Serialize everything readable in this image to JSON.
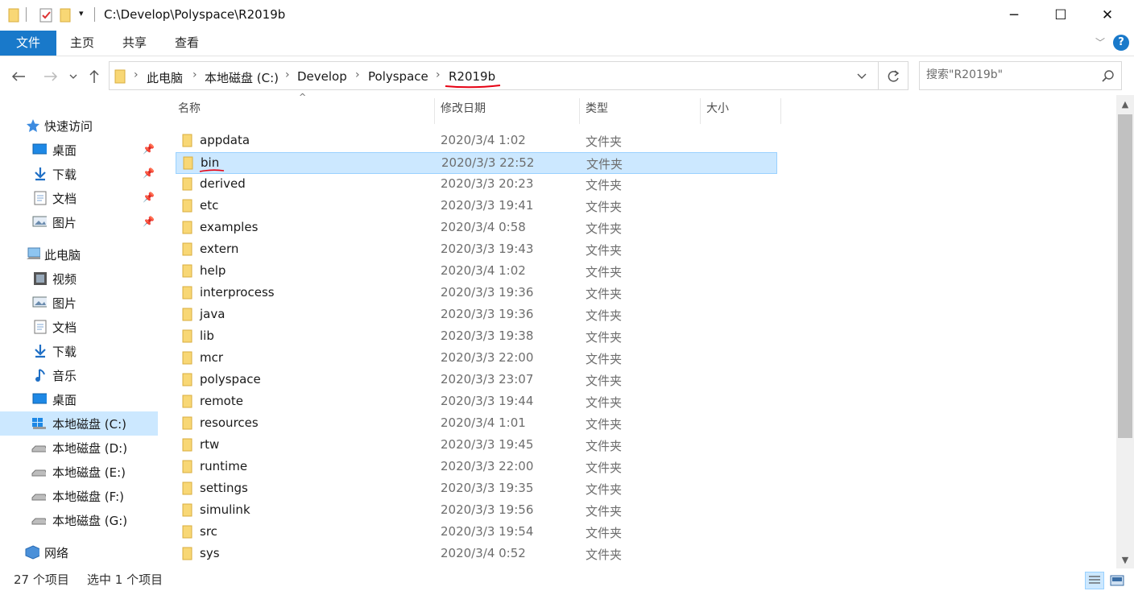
{
  "window": {
    "title": "C:\\Develop\\Polyspace\\R2019b",
    "minimize_glyph": "─",
    "maximize_glyph": "☐",
    "close_glyph": "✕"
  },
  "ribbon": {
    "tabs": [
      {
        "label": "文件"
      },
      {
        "label": "主页"
      },
      {
        "label": "共享"
      },
      {
        "label": "查看"
      }
    ],
    "help_label": "?"
  },
  "address": {
    "crumbs": [
      "此电脑",
      "本地磁盘 (C:)",
      "Develop",
      "Polyspace",
      "R2019b"
    ],
    "annotation_color": "#e60012"
  },
  "search": {
    "placeholder": "搜索\"R2019b\""
  },
  "nav": {
    "quick_access": "快速访问",
    "quick_items": [
      "桌面",
      "下载",
      "文档",
      "图片"
    ],
    "this_pc": "此电脑",
    "pc_items": [
      "视频",
      "图片",
      "文档",
      "下载",
      "音乐",
      "桌面"
    ],
    "drives": [
      "本地磁盘 (C:)",
      "本地磁盘 (D:)",
      "本地磁盘 (E:)",
      "本地磁盘 (F:)",
      "本地磁盘 (G:)"
    ],
    "network": "网络",
    "selected": "本地磁盘 (C:)"
  },
  "columns": {
    "name": "名称",
    "date": "修改日期",
    "type": "类型",
    "size": "大小"
  },
  "files": [
    {
      "name": "appdata",
      "date": "2020/3/4 1:02",
      "type": "文件夹"
    },
    {
      "name": "bin",
      "date": "2020/3/3 22:52",
      "type": "文件夹"
    },
    {
      "name": "derived",
      "date": "2020/3/3 20:23",
      "type": "文件夹"
    },
    {
      "name": "etc",
      "date": "2020/3/3 19:41",
      "type": "文件夹"
    },
    {
      "name": "examples",
      "date": "2020/3/4 0:58",
      "type": "文件夹"
    },
    {
      "name": "extern",
      "date": "2020/3/3 19:43",
      "type": "文件夹"
    },
    {
      "name": "help",
      "date": "2020/3/4 1:02",
      "type": "文件夹"
    },
    {
      "name": "interprocess",
      "date": "2020/3/3 19:36",
      "type": "文件夹"
    },
    {
      "name": "java",
      "date": "2020/3/3 19:36",
      "type": "文件夹"
    },
    {
      "name": "lib",
      "date": "2020/3/3 19:38",
      "type": "文件夹"
    },
    {
      "name": "mcr",
      "date": "2020/3/3 22:00",
      "type": "文件夹"
    },
    {
      "name": "polyspace",
      "date": "2020/3/3 23:07",
      "type": "文件夹"
    },
    {
      "name": "remote",
      "date": "2020/3/3 19:44",
      "type": "文件夹"
    },
    {
      "name": "resources",
      "date": "2020/3/4 1:01",
      "type": "文件夹"
    },
    {
      "name": "rtw",
      "date": "2020/3/3 19:45",
      "type": "文件夹"
    },
    {
      "name": "runtime",
      "date": "2020/3/3 22:00",
      "type": "文件夹"
    },
    {
      "name": "settings",
      "date": "2020/3/3 19:35",
      "type": "文件夹"
    },
    {
      "name": "simulink",
      "date": "2020/3/3 19:56",
      "type": "文件夹"
    },
    {
      "name": "src",
      "date": "2020/3/3 19:54",
      "type": "文件夹"
    },
    {
      "name": "sys",
      "date": "2020/3/4 0:52",
      "type": "文件夹"
    }
  ],
  "selected_file": "bin",
  "status": {
    "item_count": "27 个项目",
    "selection": "选中 1 个项目"
  },
  "colors": {
    "accent": "#1979ca",
    "selection_bg": "#cce8ff",
    "selection_border": "#99d1ff",
    "folder": "#f8d775"
  }
}
